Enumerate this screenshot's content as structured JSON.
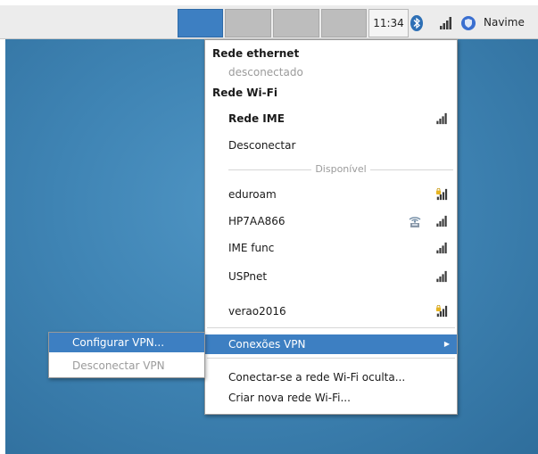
{
  "panel": {
    "clock": "11:34",
    "user_name": "Navime",
    "icons": [
      "bluetooth-icon",
      "wifi-signal-icon",
      "update-shield-icon"
    ]
  },
  "menu": {
    "ethernet_header": "Rede ethernet",
    "ethernet_status": "desconectado",
    "wifi_header": "Rede Wi-Fi",
    "connected_network": "Rede IME",
    "disconnect": "Desconectar",
    "available_label": "Disponível",
    "networks": [
      {
        "name": "eduroam",
        "secured": true,
        "adhoc": false
      },
      {
        "name": "HP7AA866",
        "secured": false,
        "adhoc": true
      },
      {
        "name": "IME func",
        "secured": false,
        "adhoc": false
      },
      {
        "name": "USPnet",
        "secured": false,
        "adhoc": false
      },
      {
        "name": "verao2016",
        "secured": true,
        "adhoc": false
      }
    ],
    "vpn_connections": "Conexões VPN",
    "connect_hidden": "Conectar-se a rede Wi-Fi oculta...",
    "create_new": "Criar nova rede Wi-Fi..."
  },
  "submenu": {
    "configure_vpn": "Configurar VPN...",
    "disconnect_vpn": "Desconectar VPN"
  },
  "colors": {
    "highlight": "#3d7fc2",
    "desktop": "#3f84b4",
    "panel": "#ececec"
  }
}
